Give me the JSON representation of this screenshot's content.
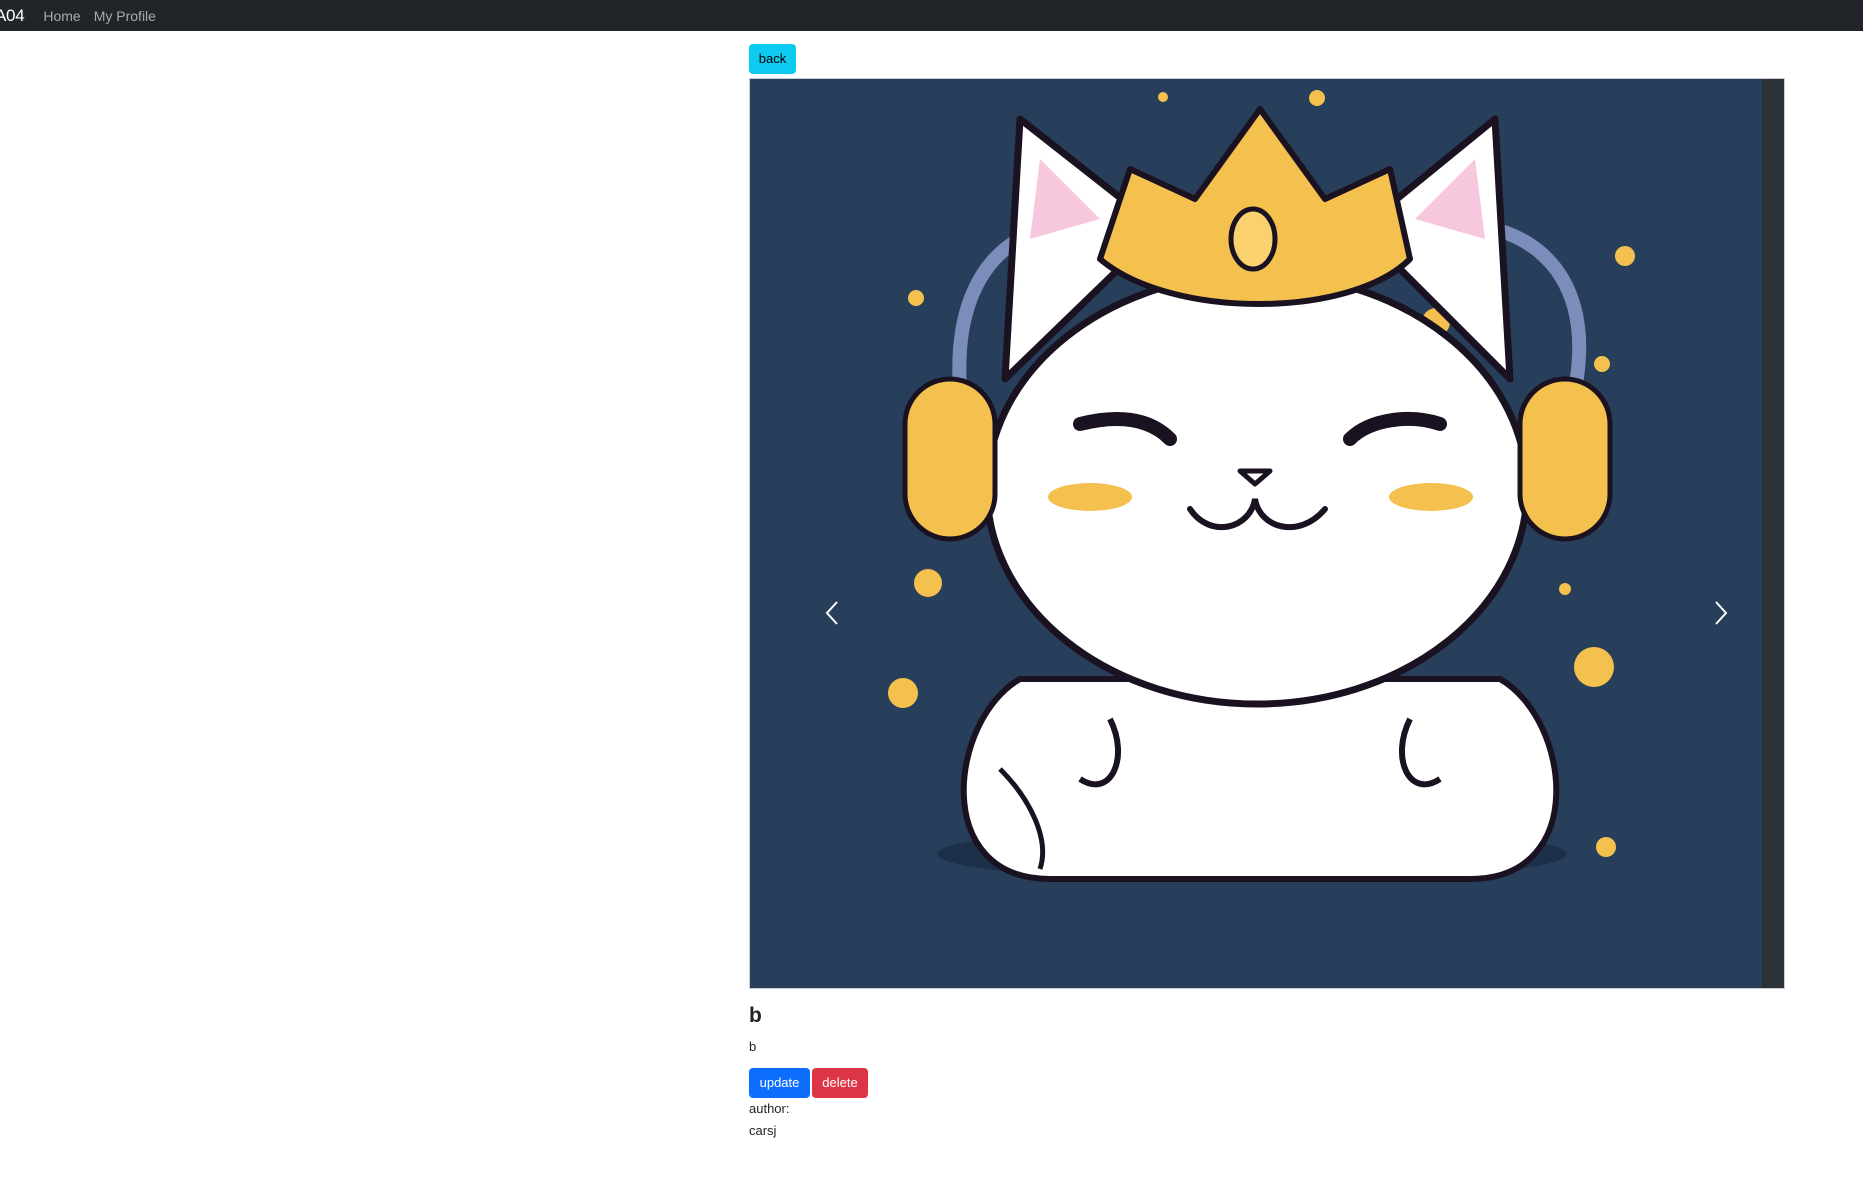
{
  "navbar": {
    "brand": "A04",
    "links": [
      "Home",
      "My Profile"
    ]
  },
  "post": {
    "back_label": "back",
    "title": "b",
    "description": "b",
    "update_label": "update",
    "delete_label": "delete",
    "author_label": "author:",
    "author_name": "carsj"
  },
  "carousel": {
    "prev_icon": "chevron-left-icon",
    "next_icon": "chevron-right-icon",
    "image_subject": "cat-with-crown-and-headphones"
  },
  "colors": {
    "navbar_bg": "#212529",
    "back_button": "#0dcaf0",
    "update_button": "#0d6efd",
    "delete_button": "#dc3545",
    "image_bg": "#283f5b"
  }
}
